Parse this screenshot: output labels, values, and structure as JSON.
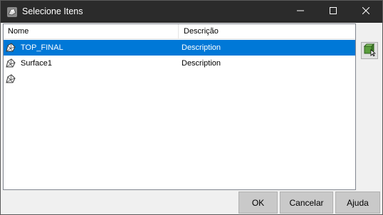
{
  "window": {
    "title": "Selecione Itens"
  },
  "list": {
    "columns": {
      "name": "Nome",
      "description": "Descrição"
    },
    "rows": [
      {
        "name": "TOP_FINAL",
        "description": "Description",
        "selected": true
      },
      {
        "name": "Surface1",
        "description": "Description",
        "selected": false
      },
      {
        "name": "",
        "description": "",
        "selected": false
      }
    ]
  },
  "buttons": {
    "ok": "OK",
    "cancel": "Cancelar",
    "help": "Ajuda"
  },
  "colors": {
    "selection": "#0078d7",
    "titlebar": "#2b2b2b"
  },
  "icons": {
    "title": "surface-app-icon",
    "row": "surface-icon",
    "side": "select-surface-icon"
  }
}
